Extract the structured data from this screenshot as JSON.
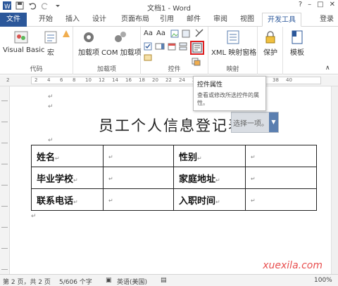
{
  "window": {
    "title": "文档1 - Word",
    "minimize": "–",
    "restore": "□",
    "close": "✕"
  },
  "tabs": {
    "items": [
      "文件",
      "开始",
      "插入",
      "设计",
      "页面布局",
      "引用",
      "邮件",
      "审阅",
      "视图",
      "开发工具"
    ],
    "active": "开发工具",
    "login": "登录"
  },
  "ribbon": {
    "code": {
      "label": "代码",
      "visual_basic": "Visual Basic",
      "macro": "宏"
    },
    "addins": {
      "label": "加载项",
      "addin": "加载项",
      "com_addin": "COM 加载项"
    },
    "controls": {
      "label": "控件"
    },
    "mapping": {
      "label": "映射",
      "xml_pane": "XML 映射窗格"
    },
    "protect": {
      "label": "保护"
    },
    "template": {
      "label": "模板"
    },
    "highlight_color": "#e02020"
  },
  "ruler": {
    "numbers": [
      "2",
      "2",
      "4",
      "6",
      "8",
      "10",
      "12",
      "14",
      "16",
      "18",
      "20",
      "22",
      "24",
      "26",
      "28",
      "30",
      "32",
      "34",
      "36",
      "38",
      "40"
    ]
  },
  "document": {
    "title": "员工个人信息登记表",
    "dropdown_placeholder": "选择一项。",
    "para_mark": "↵",
    "table": [
      [
        "姓名",
        "",
        "性别",
        ""
      ],
      [
        "毕业学校",
        "",
        "家庭地址",
        ""
      ],
      [
        "联系电话",
        "",
        "入职时间",
        ""
      ]
    ]
  },
  "tooltip": {
    "title": "控件属性",
    "description": "查看或修改所选控件的属性。"
  },
  "statusbar": {
    "page": "第 2 页，共 2 页",
    "words": "5/606 个字",
    "language": "英语(美国)",
    "zoom": "100%"
  },
  "watermark": "xuexila.com",
  "colors": {
    "file_tab": "#2b579a",
    "dropdown_arrow": "#5b7fb0",
    "watermark": "#e63b3b"
  }
}
